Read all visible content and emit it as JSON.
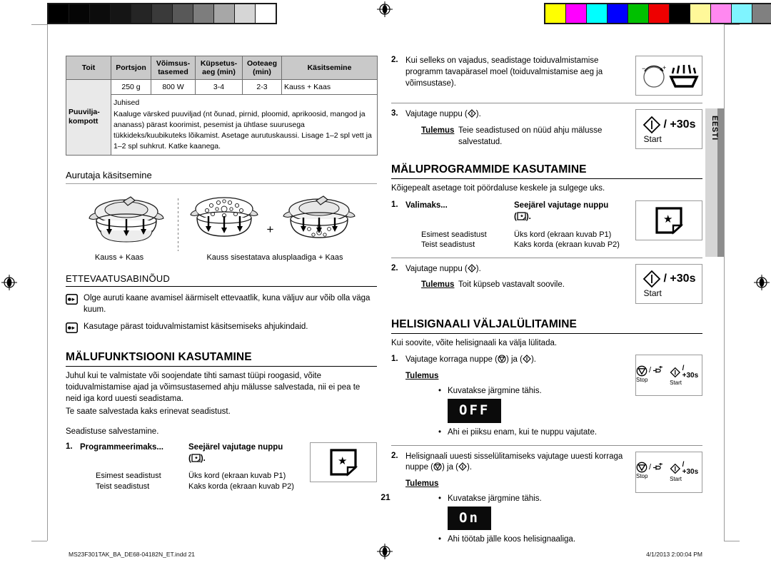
{
  "document": {
    "page_number": "21",
    "language_tab": "EESTI",
    "footer_left": "MS23F301TAK_BA_DE68-04182N_ET.indd   21",
    "footer_right": "4/1/2013   2:00:04 PM"
  },
  "calibration": {
    "gray_swatches": [
      "#000000",
      "#050505",
      "#0c0c0c",
      "#151515",
      "#252525",
      "#3a3a3a",
      "#585858",
      "#7d7d7d",
      "#a7a7a7",
      "#d6d6d6",
      "#ffffff"
    ],
    "color_swatches": [
      "#ffff00",
      "#ff00ff",
      "#00ffff",
      "#0000ff",
      "#00c000",
      "#ee0000",
      "#000000",
      "#fff899",
      "#ff88f0",
      "#7ff4ff",
      "#808080"
    ]
  },
  "table": {
    "headers": [
      "Toit",
      "Portsjon",
      "Võimsus-\ntasemed",
      "Küpsetus-\naeg (min)",
      "Ooteaeg\n(min)",
      "Käsitsemine"
    ],
    "headers_flat": [
      "Toit",
      "Portsjon",
      "Võimsus- tasemed",
      "Küpsetus- aeg (min)",
      "Ooteaeg (min)",
      "Käsitsemine"
    ],
    "header_power_l1": "Võimsus-",
    "header_power_l2": "tasemed",
    "header_cook_l1": "Küpsetus-",
    "header_cook_l2": "aeg (min)",
    "header_stand_l1": "Ooteaeg",
    "header_stand_l2": "(min)",
    "row": {
      "food_l1": "Puuvilja-",
      "food_l2": "kompott",
      "portion": "250 g",
      "power": "800 W",
      "cook_time": "3-4",
      "standing_time": "2-3",
      "handling": "Kauss + Kaas"
    },
    "instructions_title": "Juhised",
    "instructions_text": "Kaaluge värsked puuviljad (nt õunad, pirnid, ploomid, aprikoosid, mangod ja ananass) pärast koorimist, pesemist ja ühtlase suurusega tükkideks/kuubikuteks lõikamist. Asetage aurutuskaussi. Lisage 1–2 spl vett ja 1–2 spl suhkrut. Katke kaanega."
  },
  "steamer": {
    "heading": "Aurutaja käsitsemine",
    "caption_left": "Kauss + Kaas",
    "caption_right": "Kauss sisestatava alusplaadiga + Kaas",
    "plus": "+"
  },
  "cautions": {
    "heading": "ETTEVAATUSABINÕUD",
    "items": [
      "Olge auruti kaane avamisel äärmiselt ettevaatlik, kuna väljuv aur võib olla väga kuum.",
      "Kasutage pärast toiduvalmistamist käsitsemiseks ahjukindaid."
    ]
  },
  "memory_function": {
    "heading": "MÄLUFUNKTSIOONI KASUTAMINE",
    "intro": "Juhul kui te valmistate või soojendate tihti samast tüüpi roogasid, võite toiduvalmistamise ajad ja võimsustasemed ahju mälusse salvestada, nii ei pea te neid iga kord uuesti seadistama.",
    "intro2": "Te saate salvestada kaks erinevat seadistust.",
    "subtitle": "Seadistuse salvestamine.",
    "step1_num": "1.",
    "step1_colA": "Programmeerimaks...",
    "step1_colB_l1": "Seejärel vajutage nuppu",
    "step1_colB_l2": ").",
    "rows": [
      {
        "a": "Esimest seadistust",
        "b": "Üks kord (ekraan kuvab P1)"
      },
      {
        "a": "Teist seadistust",
        "b": "Kaks korda (ekraan kuvab P2)"
      }
    ]
  },
  "right_column": {
    "step2_num": "2.",
    "step2_text": "Kui selleks on vajadus, seadistage toiduvalmistamise programm tavapärasel moel (toiduvalmistamise aeg ja võimsustase).",
    "step3_num": "3.",
    "step3_text_pre": "Vajutage nuppu (",
    "step3_text_post": ").",
    "step3_result_label": "Tulemus",
    "step3_result_text": "Teie seadistused on nüüd ahju mälusse salvestatud."
  },
  "memory_programs": {
    "heading": "MÄLUPROGRAMMIDE KASUTAMINE",
    "intro": "Kõigepealt asetage toit pöördaluse keskele ja sulgege uks.",
    "step1_num": "1.",
    "step1_colA": "Valimaks...",
    "step1_colB_l1": "Seejärel vajutage nuppu",
    "step1_colB_l2": ").",
    "rows": [
      {
        "a": "Esimest seadistust",
        "b": "Üks kord (ekraan kuvab P1)"
      },
      {
        "a": "Teist seadistust",
        "b": "Kaks korda (ekraan kuvab P2)"
      }
    ],
    "step2_num": "2.",
    "step2_text_pre": "Vajutage nuppu (",
    "step2_text_post": ").",
    "step2_result_label": "Tulemus",
    "step2_result_text": "Toit küpseb vastavalt soovile."
  },
  "beeper": {
    "heading": "HELISIGNAALI VÄLJALÜLITAMINE",
    "intro": "Kui soovite, võite helisignaali ka välja lülitada.",
    "step1_num": "1.",
    "step1_text_pre": "Vajutage korraga nuppe (",
    "step1_text_mid": ") ja (",
    "step1_text_post": ").",
    "step1_result_label": "Tulemus",
    "step1_bullet1": "Kuvatakse järgmine tähis.",
    "step1_lcd": "OFF",
    "step1_bullet2": "Ahi ei piiksu enam, kui te nuppu vajutate.",
    "step2_num": "2.",
    "step2_text_pre": "Helisignaali uuesti sisselülitamiseks vajutage uuesti korraga nuppe (",
    "step2_text_mid": ") ja (",
    "step2_text_post": ").",
    "step2_result_label": "Tulemus",
    "step2_bullet1": "Kuvatakse järgmine tähis.",
    "step2_lcd": "On",
    "step2_bullet2": "Ahi töötab jälle koos helisignaaliga."
  },
  "icons": {
    "start_label": "Start",
    "start_plus30": "/ +30s",
    "stop_label": "Stop",
    "memo_icon": "memo-star-icon",
    "steam_icon": "steam-dial-icon",
    "hand_icon": "pointing-hand-icon"
  },
  "bullet_char": "•"
}
